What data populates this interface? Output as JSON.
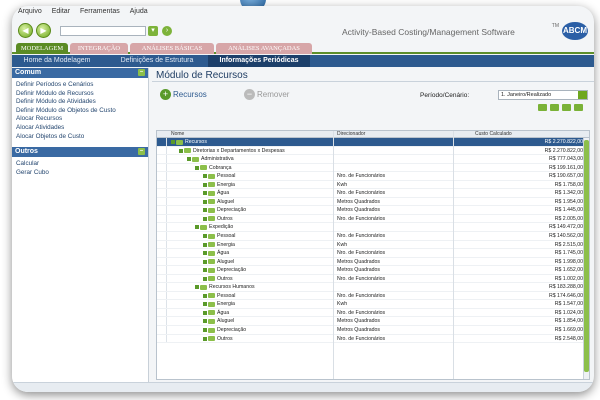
{
  "menu": [
    "Arquivo",
    "Editar",
    "Ferramentas",
    "Ajuda"
  ],
  "app_title": "Activity-Based Costing/Management Software",
  "tm_mark": "TM",
  "logo_text": "ABCM",
  "tabs": [
    "MODELAGEM",
    "INTEGRAÇÃO",
    "ANÁLISES BÁSICAS",
    "ANÁLISES AVANÇADAS"
  ],
  "subnav": [
    "Home da Modelagem",
    "Definições de Estrutura",
    "Informações Periódicas"
  ],
  "sidebar": {
    "section1_title": "Comum",
    "section1_items": [
      "Definir Períodos e Cenários",
      "Definir Módulo de Recursos",
      "Definir Módulo de Atividades",
      "Definir Módulo de Objetos de Custo",
      "Alocar Recursos",
      "Alocar Atividades",
      "Alocar Objetos de Custo"
    ],
    "section2_title": "Outros",
    "section2_items": [
      "Calcular",
      "Gerar Cubo"
    ]
  },
  "main": {
    "title": "Módulo de Recursos",
    "add_label": "Recursos",
    "remove_label": "Remover",
    "period_label": "Período/Cenário:",
    "period_value": "1. Janeiro/Realizado"
  },
  "grid": {
    "headers": [
      "Nome",
      "Direcionador",
      "Custo Calculado"
    ],
    "rows": [
      {
        "name": "Recursos",
        "driver": "",
        "cost": "R$ 2.270.822,00",
        "level": 0
      },
      {
        "name": "Diretorias x Departamentos x Despesas",
        "driver": "",
        "cost": "R$ 2.270.822,00",
        "level": 1
      },
      {
        "name": "Administrativa",
        "driver": "",
        "cost": "R$ 777.043,00",
        "level": 2
      },
      {
        "name": "Cobrança",
        "driver": "",
        "cost": "R$ 199.161,00",
        "level": 3
      },
      {
        "name": "Pessoal",
        "driver": "Nro. de Funcionários",
        "cost": "R$ 190.657,00",
        "level": 4
      },
      {
        "name": "Energia",
        "driver": "Kwh",
        "cost": "R$ 1.758,00",
        "level": 4
      },
      {
        "name": "Água",
        "driver": "Nro. de Funcionários",
        "cost": "R$ 1.342,00",
        "level": 4
      },
      {
        "name": "Aluguel",
        "driver": "Metros Quadrados",
        "cost": "R$ 1.954,00",
        "level": 4
      },
      {
        "name": "Depreciação",
        "driver": "Metros Quadrados",
        "cost": "R$ 1.445,00",
        "level": 4
      },
      {
        "name": "Outros",
        "driver": "Nro. de Funcionários",
        "cost": "R$ 2.005,00",
        "level": 4
      },
      {
        "name": "Expedição",
        "driver": "",
        "cost": "R$ 149.472,00",
        "level": 3
      },
      {
        "name": "Pessoal",
        "driver": "Nro. de Funcionários",
        "cost": "R$ 140.562,00",
        "level": 4
      },
      {
        "name": "Energia",
        "driver": "Kwh",
        "cost": "R$ 2.515,00",
        "level": 4
      },
      {
        "name": "Água",
        "driver": "Nro. de Funcionários",
        "cost": "R$ 1.745,00",
        "level": 4
      },
      {
        "name": "Aluguel",
        "driver": "Metros Quadrados",
        "cost": "R$ 1.998,00",
        "level": 4
      },
      {
        "name": "Depreciação",
        "driver": "Metros Quadrados",
        "cost": "R$ 1.652,00",
        "level": 4
      },
      {
        "name": "Outros",
        "driver": "Nro. de Funcionários",
        "cost": "R$ 1.002,00",
        "level": 4
      },
      {
        "name": "Recursos Humanos",
        "driver": "",
        "cost": "R$ 183.288,00",
        "level": 3
      },
      {
        "name": "Pessoal",
        "driver": "Nro. de Funcionários",
        "cost": "R$ 174.646,00",
        "level": 4
      },
      {
        "name": "Energia",
        "driver": "Kwh",
        "cost": "R$ 1.547,00",
        "level": 4
      },
      {
        "name": "Água",
        "driver": "Nro. de Funcionários",
        "cost": "R$ 1.024,00",
        "level": 4
      },
      {
        "name": "Aluguel",
        "driver": "Metros Quadrados",
        "cost": "R$ 1.854,00",
        "level": 4
      },
      {
        "name": "Depreciação",
        "driver": "Metros Quadrados",
        "cost": "R$ 1.669,00",
        "level": 4
      },
      {
        "name": "Outros",
        "driver": "Nro. de Funcionários",
        "cost": "R$ 2.548,00",
        "level": 4
      }
    ]
  },
  "colors": {
    "accent_green": "#5b8b24",
    "nav_blue": "#2d5a8f",
    "selected_row": "#2d5a8f",
    "tab_inactive": "#d7a6a8"
  },
  "icons": {
    "back": "arrow-left-icon",
    "forward": "arrow-right-icon",
    "add": "plus-circle-icon",
    "remove": "minus-circle-icon",
    "folder": "folder-icon"
  }
}
